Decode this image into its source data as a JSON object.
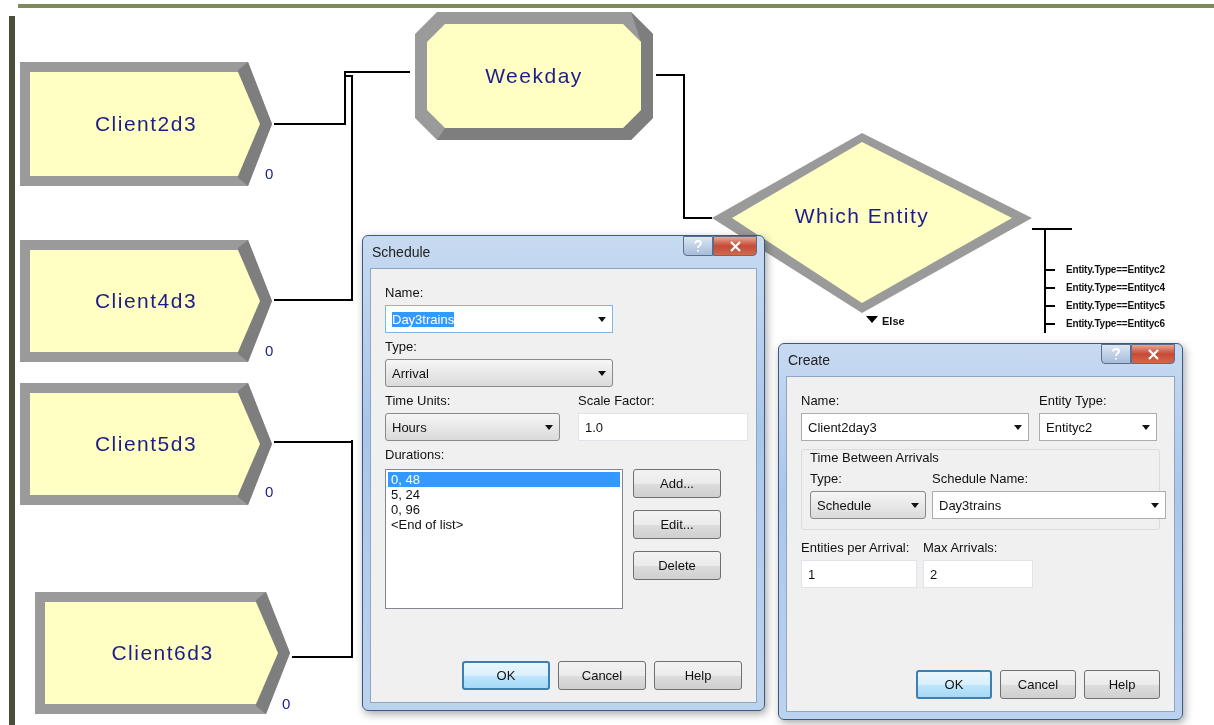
{
  "canvas": {
    "modules": [
      {
        "kind": "create",
        "label": "Client2d3",
        "count": "0"
      },
      {
        "kind": "create",
        "label": "Client4d3",
        "count": "0"
      },
      {
        "kind": "create",
        "label": "Client5d3",
        "count": "0"
      },
      {
        "kind": "create",
        "label": "Client6d3",
        "count": "0"
      },
      {
        "kind": "process",
        "label": "Weekday"
      },
      {
        "kind": "decide",
        "label": "Which Entity",
        "branches": [
          "Entity.Type==Entityc2",
          "Entity.Type==Entityc4",
          "Entity.Type==Entityc5",
          "Entity.Type==Entityc6"
        ],
        "else_label": "Else"
      }
    ]
  },
  "dialogs": [
    {
      "kind": "schedule",
      "title": "Schedule",
      "name": {
        "label": "Name:",
        "value": "Day3trains",
        "text_selected": true
      },
      "type": {
        "label": "Type:",
        "value": "Arrival"
      },
      "time_units": {
        "label": "Time Units:",
        "value": "Hours"
      },
      "scale_factor": {
        "label": "Scale Factor:",
        "value": "1.0"
      },
      "durations": {
        "label": "Durations:",
        "items": [
          {
            "text": "0, 48",
            "selected": true
          },
          {
            "text": "5, 24",
            "selected": false
          },
          {
            "text": "0, 96",
            "selected": false
          },
          {
            "text": "<End of list>",
            "selected": false
          }
        ]
      },
      "list_buttons": [
        "Add...",
        "Edit...",
        "Delete"
      ],
      "buttons": [
        {
          "label": "OK",
          "default": true
        },
        {
          "label": "Cancel",
          "default": false
        },
        {
          "label": "Help",
          "default": false
        }
      ]
    },
    {
      "kind": "create",
      "title": "Create",
      "name": {
        "label": "Name:",
        "value": "Client2day3"
      },
      "entity_type": {
        "label": "Entity Type:",
        "value": "Entityc2"
      },
      "group_title": "Time Between Arrivals",
      "type": {
        "label": "Type:",
        "value": "Schedule"
      },
      "schedule_name": {
        "label": "Schedule Name:",
        "value": "Day3trains"
      },
      "entities_per_arrival": {
        "label": "Entities per Arrival:",
        "value": "1"
      },
      "max_arrivals": {
        "label": "Max Arrivals:",
        "value": "2"
      },
      "buttons": [
        {
          "label": "OK",
          "default": true
        },
        {
          "label": "Cancel",
          "default": false
        },
        {
          "label": "Help",
          "default": false
        }
      ]
    }
  ]
}
